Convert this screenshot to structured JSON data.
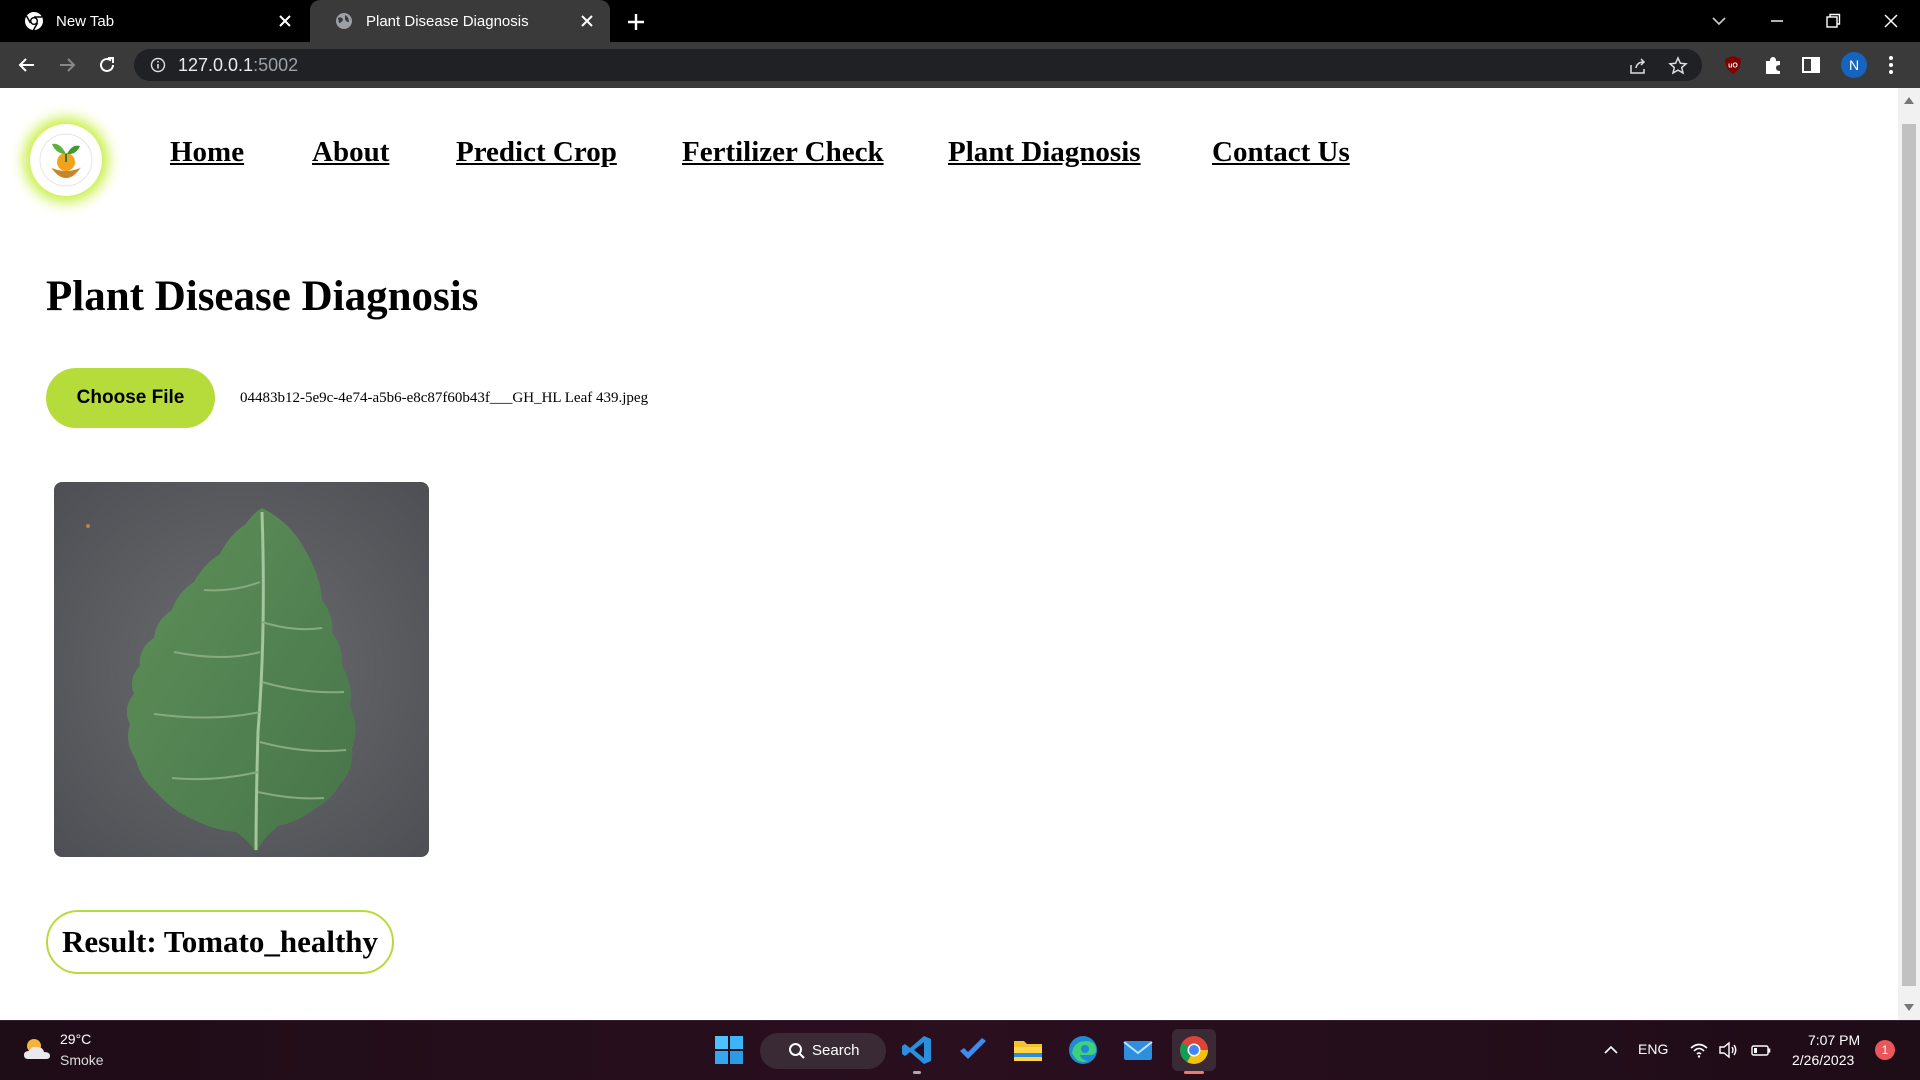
{
  "browser": {
    "tabs": [
      {
        "title": "New Tab"
      },
      {
        "title": "Plant Disease Diagnosis"
      }
    ],
    "url_host": "127.0.0.1",
    "url_port": ":5002",
    "profile_initial": "N"
  },
  "nav": {
    "links": [
      "Home",
      "About",
      "Predict Crop",
      "Fertilizer Check",
      "Plant Diagnosis",
      "Contact Us"
    ]
  },
  "page": {
    "title": "Plant Disease Diagnosis",
    "choose_file_label": "Choose File",
    "file_name": "04483b12-5e9c-4e74-a5b6-e8c87f60b43f___GH_HL Leaf 439.jpeg",
    "result_text": "Result: Tomato_healthy",
    "accent_color": "#b5dc3a"
  },
  "taskbar": {
    "weather_temp": "29°C",
    "weather_desc": "Smoke",
    "search_label": "Search",
    "language": "ENG",
    "time": "7:07 PM",
    "date": "2/26/2023",
    "notification_count": "1"
  }
}
